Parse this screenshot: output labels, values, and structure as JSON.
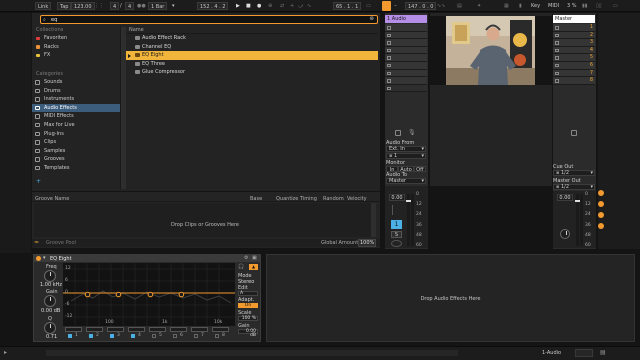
{
  "transport": {
    "link": "Link",
    "tap": "Tap",
    "tempo": "123.00",
    "time_sig_num": "4",
    "time_sig_sep": "/",
    "time_sig_den": "4",
    "quantize": "1 Bar",
    "position": "152 . 4 . 2",
    "loop_start": "65 . 1 . 1",
    "loop_length": "147 . 0 . 0",
    "key_label": "Key",
    "midi_label": "MIDI",
    "cpu": "3 %"
  },
  "browser": {
    "search_value": "eq",
    "collections_title": "Collections",
    "collections": [
      {
        "label": "Favoriten",
        "color": "#e23b3b"
      },
      {
        "label": "Racks",
        "color": "#e8923a"
      },
      {
        "label": "FX",
        "color": "#e8c53a"
      }
    ],
    "categories_title": "Categories",
    "categories": [
      {
        "label": "Sounds",
        "icon": "sounds-icon"
      },
      {
        "label": "Drums",
        "icon": "drums-icon"
      },
      {
        "label": "Instruments",
        "icon": "instruments-icon"
      },
      {
        "label": "Audio Effects",
        "icon": "audio-effects-icon"
      },
      {
        "label": "MIDI Effects",
        "icon": "midi-effects-icon"
      },
      {
        "label": "Max for Live",
        "icon": "max-for-live-icon"
      },
      {
        "label": "Plug-Ins",
        "icon": "plug-ins-icon"
      },
      {
        "label": "Clips",
        "icon": "clips-icon"
      },
      {
        "label": "Samples",
        "icon": "samples-icon"
      },
      {
        "label": "Grooves",
        "icon": "grooves-icon"
      },
      {
        "label": "Templates",
        "icon": "templates-icon"
      }
    ],
    "selected_category": "Audio Effects",
    "name_header": "Name",
    "results": [
      {
        "label": "Audio Effect Rack",
        "expandable": false
      },
      {
        "label": "Channel EQ",
        "expandable": false
      },
      {
        "label": "EQ Eight",
        "expandable": true
      },
      {
        "label": "EQ Three",
        "expandable": false
      },
      {
        "label": "Glue Compressor",
        "expandable": false
      }
    ],
    "selected_result": "EQ Eight",
    "add_label": "+"
  },
  "groove_pool": {
    "headers": [
      "Groove Name",
      "Base",
      "Quantize",
      "Timing",
      "Random",
      "Velocity"
    ],
    "empty_text": "Drop Clips or Grooves Here",
    "footer_title": "Groove Pool",
    "global_amount_label": "Global Amount",
    "global_amount_value": "100%"
  },
  "audio_track": {
    "title": "1 Audio",
    "audio_from_label": "Audio From",
    "audio_from_value": "Ext. In",
    "channel_value": "1",
    "monitor_label": "Monitor",
    "monitor_options": [
      "In",
      "Auto",
      "Off"
    ],
    "monitor_selected": "Auto",
    "audio_to_label": "Audio To",
    "audio_to_value": "Master",
    "volume_value": "0.00",
    "track_number": "1",
    "solo": "S",
    "db_scale": [
      "0",
      "12",
      "24",
      "36",
      "48",
      "60"
    ]
  },
  "master_track": {
    "title": "Master",
    "scene_numbers": [
      "1",
      "2",
      "3",
      "4",
      "5",
      "6",
      "7",
      "8"
    ],
    "cue_out_label": "Cue Out",
    "cue_out_value": "1/2",
    "master_out_label": "Master Out",
    "master_out_value": "1/2",
    "volume_value": "0.00",
    "db_scale": [
      "0",
      "12",
      "24",
      "36",
      "48",
      "60"
    ]
  },
  "device": {
    "title": "EQ Eight",
    "freq_label": "Freq",
    "freq_value": "1.00 kHz",
    "gain_label": "Gain",
    "gain_value": "0.00 dB",
    "q_label": "Q",
    "q_value": "0.71",
    "y_scale": [
      "12",
      "6",
      "0",
      "-6",
      "-12"
    ],
    "x_scale": [
      "100",
      "1k",
      "10k"
    ],
    "mode_label": "Mode",
    "mode_value": "Stereo",
    "edit_label": "Edit",
    "edit_value": "A",
    "adapt_q_label": "Adapt. Q",
    "adapt_q_value": "On",
    "scale_label": "Scale",
    "scale_value": "100 %",
    "out_gain_label": "Gain",
    "out_gain_value": "0.00 dB",
    "band_numbers": [
      "1",
      "2",
      "3",
      "4",
      "5",
      "6",
      "7",
      "8"
    ],
    "band_points": [
      {
        "band": 1,
        "freq_hz": 30,
        "gain_db": 0
      },
      {
        "band": 2,
        "freq_hz": 120,
        "gain_db": 0
      },
      {
        "band": 3,
        "freq_hz": 500,
        "gain_db": 0
      },
      {
        "band": 4,
        "freq_hz": 2000,
        "gain_db": 0
      }
    ],
    "accent": "#f29a2e"
  },
  "drop_effects_text": "Drop Audio Effects Here",
  "status": {
    "track_name": "1-Audio"
  },
  "colors": {
    "accent": "#f29a2e",
    "selected_row": "#f1b53c",
    "selected_nav": "#3d5d7d",
    "track_header": "#b58ee8",
    "master_header": "#ffffff",
    "meter_green": "#3ec45a",
    "track_number_blue": "#4ab0e6"
  }
}
